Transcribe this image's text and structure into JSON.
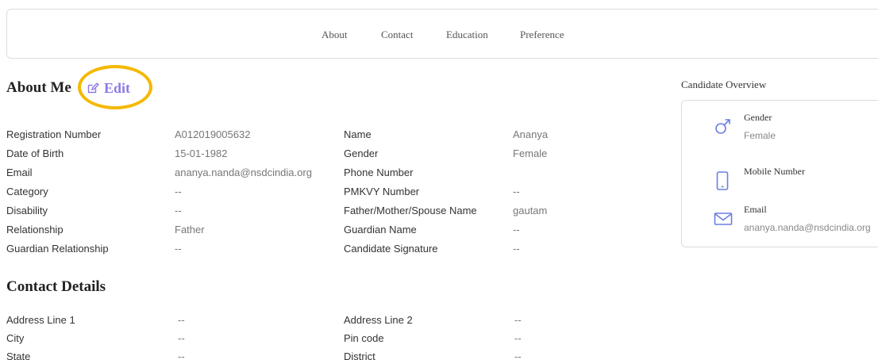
{
  "nav": {
    "tabs": [
      {
        "label": "About"
      },
      {
        "label": "Contact"
      },
      {
        "label": "Education"
      },
      {
        "label": "Preference"
      }
    ]
  },
  "about": {
    "title": "About Me",
    "edit_label": "Edit",
    "left_fields": [
      {
        "label": "Registration Number",
        "value": "A012019005632"
      },
      {
        "label": "Date of Birth",
        "value": "15-01-1982"
      },
      {
        "label": "Email",
        "value": "ananya.nanda@nsdcindia.org"
      },
      {
        "label": "Category",
        "value": "--"
      },
      {
        "label": "Disability",
        "value": "--"
      },
      {
        "label": "Relationship",
        "value": "Father"
      },
      {
        "label": "Guardian Relationship",
        "value": "--"
      }
    ],
    "right_fields": [
      {
        "label": "Name",
        "value": "Ananya"
      },
      {
        "label": "Gender",
        "value": "Female"
      },
      {
        "label": "Phone Number",
        "value": ""
      },
      {
        "label": "PMKVY Number",
        "value": "--"
      },
      {
        "label": "Father/Mother/Spouse Name",
        "value": "gautam"
      },
      {
        "label": "Guardian Name",
        "value": "--"
      },
      {
        "label": "Candidate Signature",
        "value": "--"
      }
    ]
  },
  "contact": {
    "title": "Contact Details",
    "left_fields": [
      {
        "label": "Address Line 1",
        "value": "--"
      },
      {
        "label": "City",
        "value": "--"
      },
      {
        "label": "State",
        "value": "--"
      }
    ],
    "right_fields": [
      {
        "label": "Address Line 2",
        "value": "--"
      },
      {
        "label": "Pin code",
        "value": "--"
      },
      {
        "label": "District",
        "value": "--"
      }
    ]
  },
  "overview": {
    "title": "Candidate Overview",
    "items": [
      {
        "label": "Gender",
        "value": "Female",
        "icon": "male-gender-icon"
      },
      {
        "label": "Mobile Number",
        "value": "",
        "icon": "mobile-phone-icon"
      },
      {
        "label": "Email",
        "value": "ananya.nanda@nsdcindia.org",
        "icon": "envelope-icon"
      }
    ]
  },
  "colors": {
    "accent": "#8c7ae6",
    "highlight": "#f5b800",
    "icon": "#6c7ee1"
  }
}
